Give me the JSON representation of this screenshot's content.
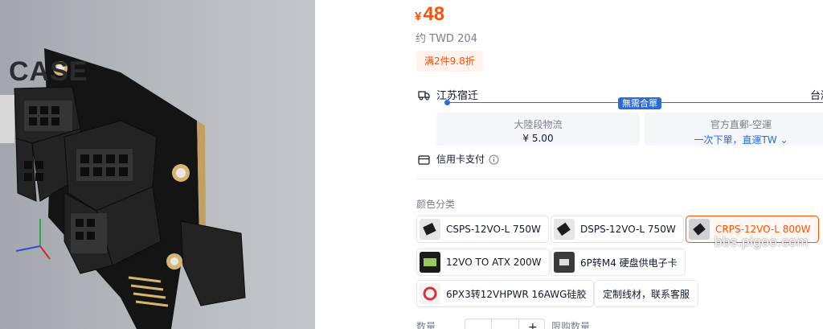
{
  "render": {
    "label": "CASE",
    "pcb_marks": [
      "2",
      "1",
      "2"
    ]
  },
  "price": {
    "currency": "¥",
    "amount": "48"
  },
  "approx_price": "约 TWD 204",
  "promo": "满2件9.8折",
  "shipping": {
    "origin": "江苏宿迁",
    "destination": "台湾",
    "badge": "無需合單",
    "option_a": {
      "title": "大陸段物流",
      "value": "¥ 5.00"
    },
    "option_b": {
      "title": "官方直郵-空運",
      "value": "一次下單，直運TW"
    }
  },
  "payment": {
    "label": "信用卡支付"
  },
  "variants": {
    "label": "颜色分类",
    "items": [
      {
        "label": "CSPS-12VO-L 750W",
        "thumb": "psu-board-dark"
      },
      {
        "label": "DSPS-12VO-L 750W",
        "thumb": "psu-board-dark"
      },
      {
        "label": "CRPS-12VO-L 800W",
        "thumb": "psu-board-dark",
        "selected": true
      },
      {
        "label": "12VO TO ATX 200W",
        "thumb": "pcb-board-green"
      },
      {
        "label": "6P转M4 硬盘供电子卡",
        "thumb": "connector-card"
      },
      {
        "label": "6PX3转12VHPWR 16AWG硅胶",
        "thumb": "cable-red"
      },
      {
        "label": "定制线材，联系客服",
        "thumb": null
      }
    ]
  },
  "quantity": {
    "label": "数量",
    "stock": "限购数量"
  },
  "watermark": "bbs.pigoo.com",
  "colors": {
    "accent": "#ff5000",
    "blue": "#2a6cde",
    "text": "#11192d",
    "muted": "#7a7f8c"
  }
}
